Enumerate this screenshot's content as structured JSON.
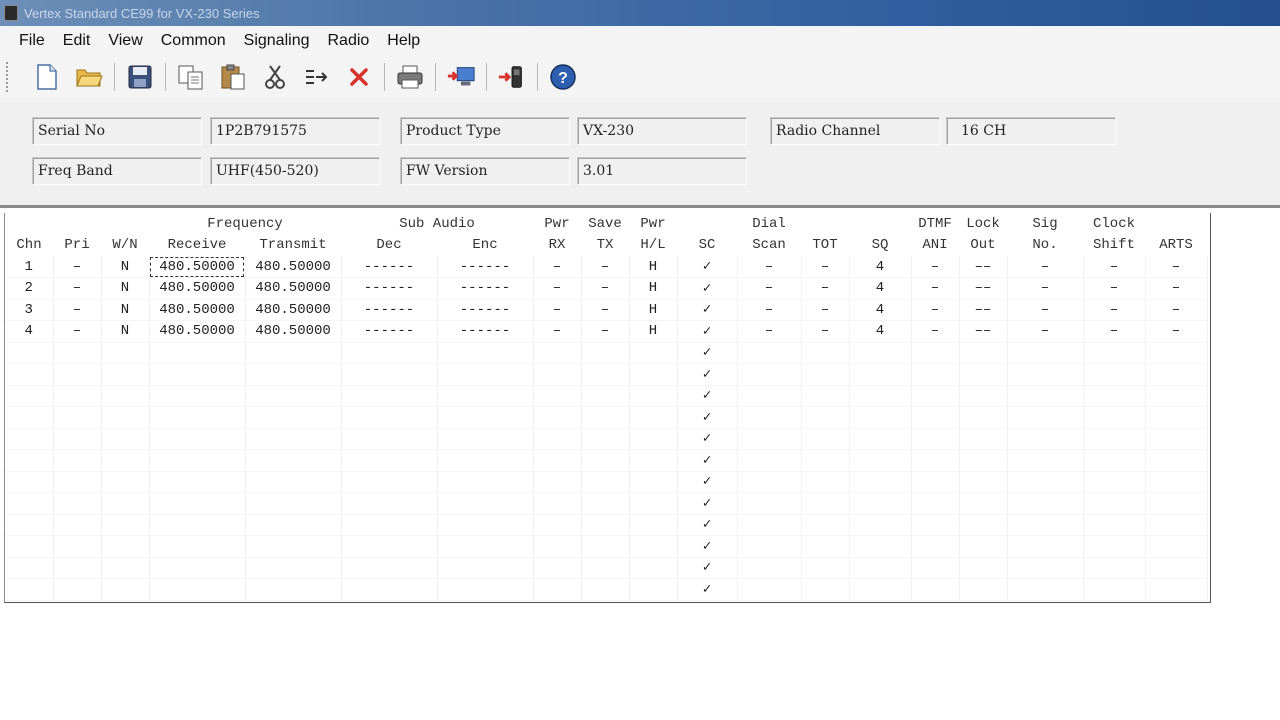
{
  "window": {
    "title": "Vertex Standard CE99 for VX-230 Series"
  },
  "menu": [
    "File",
    "Edit",
    "View",
    "Common",
    "Signaling",
    "Radio",
    "Help"
  ],
  "toolbar": {
    "buttons": [
      "new-file-icon",
      "open-folder-icon",
      "save-icon",
      "copy-icon",
      "paste-icon",
      "cut-icon",
      "insert-icon",
      "delete-icon",
      "print-icon",
      "read-from-radio-icon",
      "write-to-radio-icon",
      "help-icon"
    ]
  },
  "info": {
    "serial_label": "Serial No",
    "serial_value": "1P2B791575",
    "product_label": "Product Type",
    "product_value": "VX-230",
    "channel_label": "Radio Channel",
    "channel_value": "16 CH",
    "band_label": "Freq Band",
    "band_value": "UHF(450-520)",
    "fw_label": "FW Version",
    "fw_value": "3.01"
  },
  "grid": {
    "header_groups": {
      "frequency": "Frequency",
      "sub_audio": "Sub Audio",
      "pwr_rx": "Pwr",
      "save_tx": "Save",
      "pwr_hl": "Pwr",
      "dial": "Dial",
      "dtmf": "DTMF",
      "lock": "Lock",
      "sig": "Sig",
      "clock": "Clock"
    },
    "columns": [
      "Chn",
      "Pri",
      "W/N",
      "Receive",
      "Transmit",
      "Dec",
      "Enc",
      "RX",
      "TX",
      "H/L",
      "SC",
      "Scan",
      "TOT",
      "SQ",
      "ANI",
      "Out",
      "No.",
      "Shift",
      "ARTS"
    ],
    "rows": [
      [
        "1",
        "–",
        "N",
        "480.50000",
        "480.50000",
        "------",
        "------",
        "–",
        "–",
        "H",
        "✓",
        "–",
        "–",
        "4",
        "–",
        "––",
        "–",
        "–",
        "–"
      ],
      [
        "2",
        "–",
        "N",
        "480.50000",
        "480.50000",
        "------",
        "------",
        "–",
        "–",
        "H",
        "✓",
        "–",
        "–",
        "4",
        "–",
        "––",
        "–",
        "–",
        "–"
      ],
      [
        "3",
        "–",
        "N",
        "480.50000",
        "480.50000",
        "------",
        "------",
        "–",
        "–",
        "H",
        "✓",
        "–",
        "–",
        "4",
        "–",
        "––",
        "–",
        "–",
        "–"
      ],
      [
        "4",
        "–",
        "N",
        "480.50000",
        "480.50000",
        "------",
        "------",
        "–",
        "–",
        "H",
        "✓",
        "–",
        "–",
        "4",
        "–",
        "––",
        "–",
        "–",
        "–"
      ]
    ],
    "empty_row_sc": "✓",
    "empty_row_count": 12
  }
}
